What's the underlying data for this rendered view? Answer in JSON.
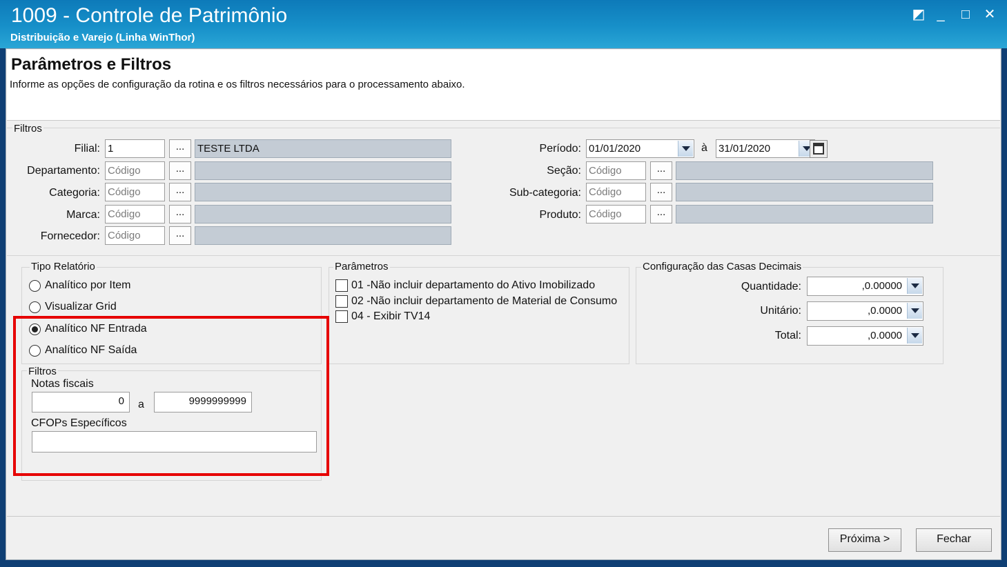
{
  "window": {
    "title": "1009 - Controle de Patrimônio",
    "subtitle": "Distribuição e Varejo (Linha WinThor)",
    "controls": {
      "restore": "◩",
      "minimize": "_",
      "maximize": "□",
      "close": "✕"
    }
  },
  "header": {
    "title": "Parâmetros e Filtros",
    "description": "Informe as opções de configuração da rotina e os filtros necessários para o processamento abaixo."
  },
  "filtros": {
    "label": "Filtros",
    "filial": {
      "label": "Filial:",
      "value": "1",
      "description": "TESTE  LTDA"
    },
    "departamento": {
      "label": "Departamento:",
      "placeholder": "Código"
    },
    "categoria": {
      "label": "Categoria:",
      "placeholder": "Código"
    },
    "marca": {
      "label": "Marca:",
      "placeholder": "Código"
    },
    "fornecedor": {
      "label": "Fornecedor:",
      "placeholder": "Código"
    },
    "periodo": {
      "label": "Período:",
      "start": "01/01/2020",
      "sep": "à",
      "end": "31/01/2020"
    },
    "secao": {
      "label": "Seção:",
      "placeholder": "Código"
    },
    "subcategoria": {
      "label": "Sub-categoria:",
      "placeholder": "Código"
    },
    "produto": {
      "label": "Produto:",
      "placeholder": "Código"
    },
    "lookup_label": "..."
  },
  "tipo_relatorio": {
    "label": "Tipo Relatório",
    "options": [
      "Analítico por Item",
      "Visualizar Grid",
      "Analítico NF Entrada",
      "Analítico NF Saída"
    ],
    "selected_index": 2
  },
  "sub_filtros": {
    "label": "Filtros",
    "notas_label": "Notas fiscais",
    "nota_inicio": "0",
    "sep": "a",
    "nota_fim": "9999999999",
    "cfops_label": "CFOPs Específicos",
    "cfops_value": ""
  },
  "parametros": {
    "label": "Parâmetros",
    "items": [
      "01 -Não incluir departamento do Ativo Imobilizado",
      "02 -Não incluir departamento de Material de Consumo",
      "04 - Exibir TV14"
    ]
  },
  "casas_decimais": {
    "label": "Configuração das Casas Decimais",
    "quantidade": {
      "label": "Quantidade:",
      "value": ",0.00000"
    },
    "unitario": {
      "label": "Unitário:",
      "value": ",0.0000"
    },
    "total": {
      "label": "Total:",
      "value": ",0.0000"
    }
  },
  "buttons": {
    "proxima": "Próxima >",
    "fechar": "Fechar"
  },
  "colors": {
    "titlebar": "#1790c9",
    "highlight": "#e60000",
    "readonly_field": "#c4ccd5"
  }
}
